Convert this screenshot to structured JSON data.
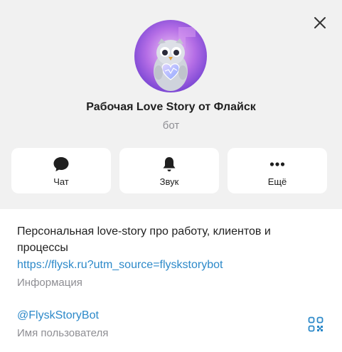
{
  "profile": {
    "title": "Рабочая Love Story от Флайск",
    "subtitle": "бот",
    "avatar_icon": "owl-avatar"
  },
  "actions": [
    {
      "label": "Чат",
      "icon": "chat-icon"
    },
    {
      "label": "Звук",
      "icon": "bell-icon"
    },
    {
      "label": "Ещё",
      "icon": "more-icon"
    }
  ],
  "info": {
    "description": "Персональная love-story про работу, клиентов и процессы",
    "link": "https://flysk.ru?utm_source=flyskstorybot",
    "caption": "Информация"
  },
  "username": {
    "value": "@FlyskStoryBot",
    "caption": "Имя пользователя"
  },
  "colors": {
    "header_bg": "#f1f1f1",
    "link": "#2c89c9",
    "secondary_text": "#8e8e93"
  }
}
